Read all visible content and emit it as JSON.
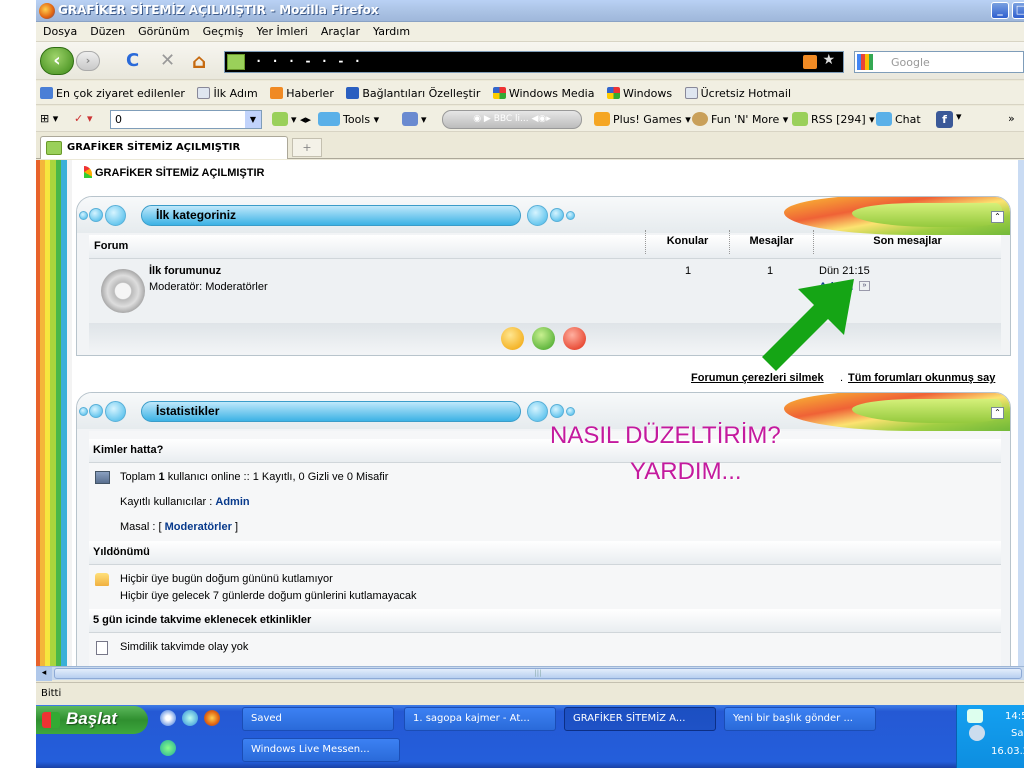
{
  "window": {
    "title": "GRAFİKER SİTEMİZ AÇILMIŞTIR - Mozilla Firefox",
    "min_label": "_",
    "max_label": "□"
  },
  "menu": [
    "Dosya",
    "Düzen",
    "Görünüm",
    "Geçmiş",
    "Yer İmleri",
    "Araçlar",
    "Yardım"
  ],
  "nav": {
    "back": "‹",
    "forward": "›",
    "reload": "C",
    "stop": "✕",
    "home": "⌂",
    "url": "· · ·  -   · -  ·",
    "search_placeholder": "Google"
  },
  "bookmarks": [
    {
      "label": "En çok ziyaret edilenler",
      "color": "#4a7fd6"
    },
    {
      "label": "İlk Adım",
      "color": "#dfe6f0"
    },
    {
      "label": "Haberler",
      "color": "#f08a24"
    },
    {
      "label": "Bağlantıları Özelleştir",
      "color": "#2a5fc0"
    },
    {
      "label": "Windows Media",
      "color": "#f0a030"
    },
    {
      "label": "Windows",
      "color": "#f0a030"
    },
    {
      "label": "Ücretsiz Hotmail",
      "color": "#dfe6f0"
    }
  ],
  "toolbar": {
    "combo_value": "0",
    "tools": "Tools",
    "media_label": "BBC li...",
    "plus_games": "Plus! Games",
    "fun": "Fun 'N' More",
    "rss": "RSS [294]",
    "chat": "Chat",
    "overflow": "»"
  },
  "tab": {
    "label": "GRAFİKER SİTEMİZ AÇILMIŞTIR",
    "new_tab": "+"
  },
  "page": {
    "title": "GRAFİKER SİTEMİZ AÇILMIŞTIR",
    "category": {
      "header": "İlk kategoriniz",
      "collapse": "⌃",
      "columns": [
        "Forum",
        "Konular",
        "Mesajlar",
        "Son mesajlar"
      ],
      "row": {
        "name": "İlk forumunuz",
        "moderator": "Moderatör: Moderatörler",
        "topics": "1",
        "posts": "1",
        "last_date": "Dün 21:15",
        "last_user": "Admin",
        "go": "»"
      }
    },
    "links": {
      "cookies": "Forumun çerezleri silmek",
      "separator": ".",
      "mark_read": "Tüm forumları okunmuş say"
    },
    "stats": {
      "header": "İstatistikler",
      "whos_online_title": "Kimler hatta?",
      "online_prefix": "Toplam ",
      "online_count": "1",
      "online_suffix": " kullanıcı online :: 1 Kayıtlı, 0 Gizli ve 0 Misafir",
      "registered_label": "Kayıtlı kullanıcılar : ",
      "registered_user": "Admin",
      "legend_label": "Masal : ",
      "legend_open": "[ ",
      "legend_group": "Moderatörler",
      "legend_close": " ]",
      "birthdays_title": "Yıldönümü",
      "bday1": "Hiçbir üye bugün doğum gününü kutlamıyor",
      "bday2": "Hiçbir üye gelecek 7 günlerde doğum günlerini kutlamayacak",
      "events_title": "5 gün icinde takvime eklenecek etkinlikler",
      "events_none": "Simdilik takvimde olay yok"
    },
    "overlay_line1": "NASIL DÜZELTİRİM?",
    "overlay_line2": "YARDIM..."
  },
  "status": "Bitti",
  "taskbar": {
    "start": "Başlat",
    "tasks": [
      "Saved",
      "1. sagopa kajmer - At...",
      "GRAFİKER SİTEMİZ A...",
      "Yeni bir başlık gönder ...",
      "Windows Live Messen..."
    ],
    "time": "14:5",
    "day": "Sal",
    "date": "16.03.2"
  },
  "colors": {
    "accent_green": "#15a515",
    "overlay_pink": "#c41a9e",
    "link_blue": "#083a8c"
  }
}
